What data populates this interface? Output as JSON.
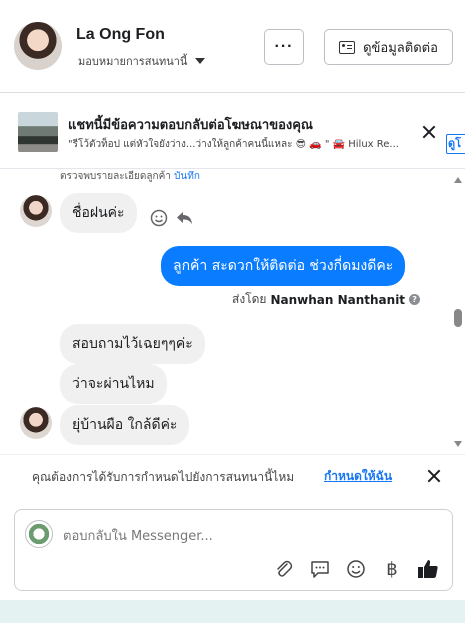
{
  "header": {
    "contact_name": "La Ong Fon",
    "assign_label": "มอบหมายการสนทนานี้",
    "more_label": "···",
    "view_contact_label": "ดูข้อมูลติดต่อ"
  },
  "ad_notice": {
    "title": "แชทนี้มีข้อความตอบกลับต่อโฆษณาของคุณ",
    "snippet": "\"รีโว้ตัวท็อป แต่หัวใจยังว่าง...ว่างให้ลูกค้าคนนี้แหละ 😎 🚗 \" 🚘 Hilux Re...",
    "link_label": "ดูโ"
  },
  "chat": {
    "cut_line_text": "ตรวจพบรายละเอียดลูกค้า",
    "cut_line_link": "บันทึก",
    "messages": [
      {
        "side": "in",
        "text": "ชื่อฝนค่ะ"
      },
      {
        "side": "out",
        "text": "ลูกค้า สะดวกให้ติดต่อ ช่วงกี่ดมงดีคะ"
      },
      {
        "side": "in",
        "text": "สอบถามไว้เฉยๆๆค่ะ"
      },
      {
        "side": "in",
        "text": "ว่าจะผ่านไหม"
      },
      {
        "side": "in",
        "text": "ยุ่บ้านผือ ใกล้ดีค่ะ"
      }
    ],
    "sent_by_prefix": "ส่งโดย",
    "sent_by_name": "Nanwhan Nanthanit",
    "help_symbol": "?"
  },
  "prompt": {
    "text": "คุณต้องการได้รับการกำหนดไปยังการสนทนานี้ไหม",
    "link": "กำหนดให้ฉัน"
  },
  "composer": {
    "placeholder": "ตอบกลับใน Messenger...",
    "baht_symbol": "฿"
  },
  "colors": {
    "accent": "#0a7cff",
    "link": "#1877f2",
    "incoming_bubble": "#f0f0f0"
  }
}
